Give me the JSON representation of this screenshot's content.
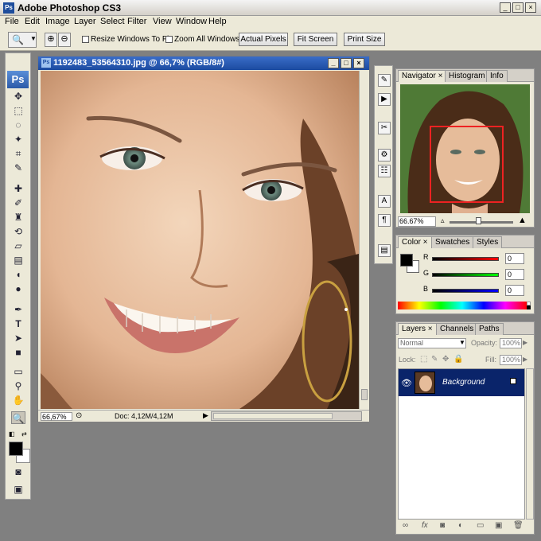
{
  "app": {
    "title": "Adobe Photoshop CS3",
    "icon": "photoshop-icon"
  },
  "window_controls": {
    "minimize": "_",
    "maximize": "□",
    "close": "×"
  },
  "menu": [
    "File",
    "Edit",
    "Image",
    "Layer",
    "Select",
    "Filter",
    "View",
    "Window",
    "Help"
  ],
  "options": {
    "resize_windows": "Resize Windows To Fit",
    "zoom_all": "Zoom All Windows",
    "actual_pixels": "Actual Pixels",
    "fit_screen": "Fit Screen",
    "print_size": "Print Size"
  },
  "tools": {
    "ps_logo": "Ps"
  },
  "document": {
    "title": "1192483_53564310.jpg @ 66,7% (RGB/8#)",
    "zoom": "66,67%",
    "doc_size": "Doc: 4,12M/4,12M"
  },
  "navigator": {
    "tabs": [
      "Navigator",
      "Histogram",
      "Info"
    ],
    "zoom": "66.67%"
  },
  "color": {
    "tabs": [
      "Color",
      "Swatches",
      "Styles"
    ],
    "r_label": "R",
    "g_label": "G",
    "b_label": "B",
    "r": "0",
    "g": "0",
    "b": "0",
    "foreground": "#000000",
    "background": "#ffffff"
  },
  "layers": {
    "tabs": [
      "Layers",
      "Channels",
      "Paths"
    ],
    "blend_mode": "Normal",
    "opacity_label": "Opacity:",
    "opacity": "100%",
    "lock_label": "Lock:",
    "fill_label": "Fill:",
    "fill": "100%",
    "layer_name": "Background"
  }
}
